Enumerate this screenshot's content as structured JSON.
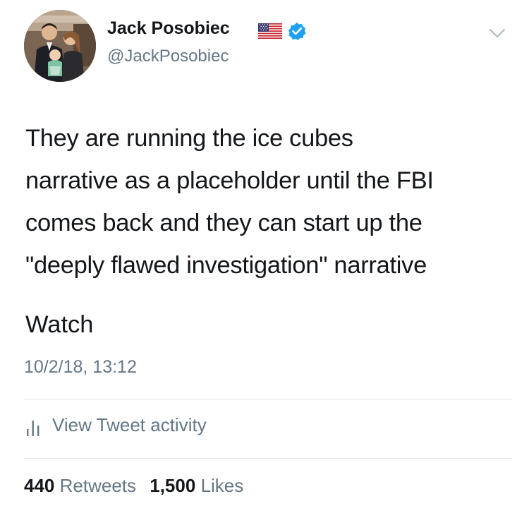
{
  "tweet": {
    "author": {
      "display_name": "Jack Posobiec",
      "handle": "@JackPosobiec",
      "flag_icon": "us-flag-icon",
      "verified_icon": "verified-badge-icon",
      "verified_color": "#1da1f2"
    },
    "text_lines": [
      "They are running the ice cubes",
      "narrative as a placeholder until the FBI",
      "comes back and they can start up the",
      "\"deeply flawed investigation\" narrative"
    ],
    "watch_text": "Watch",
    "timestamp": "10/2/18, 13:12",
    "activity_label": "View Tweet activity",
    "activity_icon": "bar-chart-icon",
    "menu_icon": "chevron-down-icon",
    "stats": {
      "retweets_count": "440",
      "retweets_label": "Retweets",
      "likes_count": "1,500",
      "likes_label": "Likes"
    },
    "colors": {
      "text": "#14171a",
      "secondary": "#657786",
      "divider": "#e1e8ed"
    }
  }
}
